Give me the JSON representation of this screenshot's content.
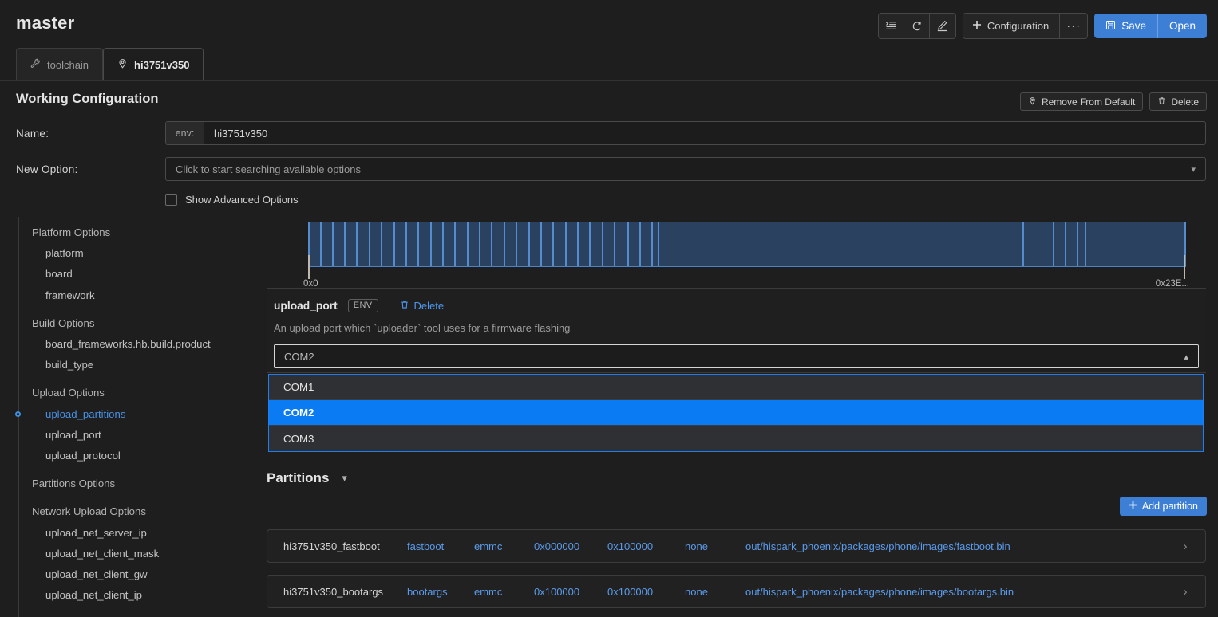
{
  "header": {
    "title": "master",
    "toolbar": {
      "icons": [
        {
          "name": "list-view-icon",
          "label": "List"
        },
        {
          "name": "refresh-icon",
          "label": "Refresh"
        },
        {
          "name": "edit-pencil-icon",
          "label": "Edit"
        }
      ],
      "configuration_label": "Configuration",
      "more_label": "···",
      "save_label": "Save",
      "open_label": "Open"
    }
  },
  "tabs": [
    {
      "label": "toolchain",
      "icon": "wrench-icon",
      "active": false
    },
    {
      "label": "hi3751v350",
      "icon": "location-pin-icon",
      "active": true
    }
  ],
  "working_config": {
    "title": "Working Configuration",
    "remove_from_default_label": "Remove From Default",
    "delete_label": "Delete",
    "name_label": "Name:",
    "name_prefix": "env:",
    "name_value": "hi3751v350",
    "new_option_label": "New Option:",
    "new_option_placeholder": "Click to start searching available options",
    "show_advanced_label": "Show Advanced Options",
    "show_advanced_checked": false
  },
  "tree": {
    "items": [
      {
        "label": "Platform Options",
        "level": "group",
        "active": false,
        "marker": false
      },
      {
        "label": "platform",
        "level": "child",
        "active": false,
        "marker": false
      },
      {
        "label": "board",
        "level": "child",
        "active": false,
        "marker": false
      },
      {
        "label": "framework",
        "level": "child",
        "active": false,
        "marker": false
      },
      {
        "label": "Build Options",
        "level": "group",
        "active": false,
        "marker": false
      },
      {
        "label": "board_frameworks.hb.build.product",
        "level": "child",
        "active": false,
        "marker": false
      },
      {
        "label": "build_type",
        "level": "child",
        "active": false,
        "marker": false
      },
      {
        "label": "Upload Options",
        "level": "group",
        "active": false,
        "marker": false
      },
      {
        "label": "upload_partitions",
        "level": "child",
        "active": true,
        "marker": true
      },
      {
        "label": "upload_port",
        "level": "child",
        "active": false,
        "marker": false
      },
      {
        "label": "upload_protocol",
        "level": "child",
        "active": false,
        "marker": false
      },
      {
        "label": "Partitions Options",
        "level": "group",
        "active": false,
        "marker": false
      },
      {
        "label": "Network Upload Options",
        "level": "group",
        "active": false,
        "marker": false
      },
      {
        "label": "upload_net_server_ip",
        "level": "child",
        "active": false,
        "marker": false
      },
      {
        "label": "upload_net_client_mask",
        "level": "child",
        "active": false,
        "marker": false
      },
      {
        "label": "upload_net_client_gw",
        "level": "child",
        "active": false,
        "marker": false
      },
      {
        "label": "upload_net_client_ip",
        "level": "child",
        "active": false,
        "marker": false
      }
    ]
  },
  "partition_map": {
    "axis_start_label": "0x0",
    "axis_end_label": "0x23E...",
    "bar_color": "#2b4160",
    "divider_color": "#548ccd",
    "boundaries_pct": [
      0.0,
      1.35,
      2.73,
      4.1,
      5.5,
      6.9,
      8.3,
      9.7,
      11.1,
      12.5,
      13.9,
      15.3,
      16.7,
      18.1,
      19.5,
      20.9,
      22.3,
      23.7,
      25.1,
      26.5,
      27.9,
      29.3,
      30.7,
      32.1,
      33.5,
      34.9,
      36.4,
      37.8,
      39.2,
      39.9,
      81.5,
      85.0,
      86.3,
      87.7,
      88.6,
      100.0
    ]
  },
  "option_card": {
    "name": "upload_port",
    "scope_badge": "ENV",
    "delete_label": "Delete",
    "description": "An upload port which `uploader` tool uses for a firmware flashing",
    "selected_value": "COM2",
    "options": [
      {
        "label": "COM1",
        "selected": false
      },
      {
        "label": "COM2",
        "selected": true
      },
      {
        "label": "COM3",
        "selected": false
      }
    ]
  },
  "partitions": {
    "title": "Partitions",
    "add_label": "Add partition",
    "rows": [
      {
        "name": "hi3751v350_fastboot",
        "type": "fastboot",
        "fs": "emmc",
        "offset": "0x000000",
        "size": "0x100000",
        "flags": "none",
        "image": "out/hispark_phoenix/packages/phone/images/fastboot.bin",
        "arrow": "›"
      },
      {
        "name": "hi3751v350_bootargs",
        "type": "bootargs",
        "fs": "emmc",
        "offset": "0x100000",
        "size": "0x100000",
        "flags": "none",
        "image": "out/hispark_phoenix/packages/phone/images/bootargs.bin",
        "arrow": "›"
      }
    ]
  },
  "colors": {
    "accent_blue": "#3e7fd6",
    "link_blue": "#5b9bea",
    "highlight_blue": "#0a7bf2",
    "background": "#1e1e1e",
    "panel": "#212122"
  }
}
